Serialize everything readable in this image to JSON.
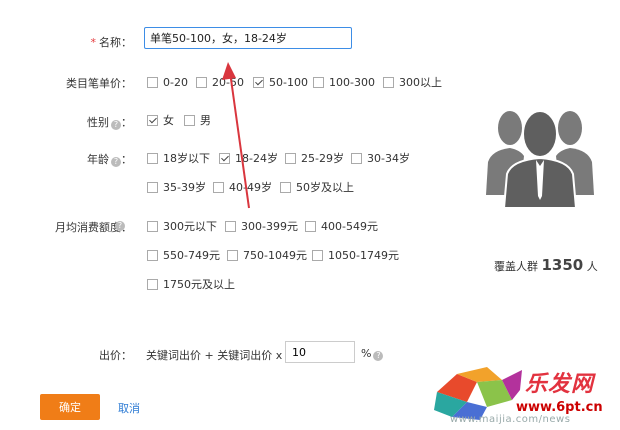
{
  "form": {
    "name_label": "名称：",
    "name_required": "*",
    "name_value": "单笔50-100，女，18-24岁",
    "price_label": "类目笔单价：",
    "price_options": [
      {
        "label": "0-20",
        "checked": false
      },
      {
        "label": "20-50",
        "checked": false
      },
      {
        "label": "50-100",
        "checked": true
      },
      {
        "label": "100-300",
        "checked": false
      },
      {
        "label": "300以上",
        "checked": false
      }
    ],
    "gender_label": "性别",
    "gender_colon": "：",
    "gender_options": [
      {
        "label": "女",
        "checked": true
      },
      {
        "label": "男",
        "checked": false
      }
    ],
    "age_label": "年龄",
    "age_colon": "：",
    "age_options": [
      {
        "label": "18岁以下",
        "checked": false
      },
      {
        "label": "18-24岁",
        "checked": true
      },
      {
        "label": "25-29岁",
        "checked": false
      },
      {
        "label": "30-34岁",
        "checked": false
      },
      {
        "label": "35-39岁",
        "checked": false
      },
      {
        "label": "40-49岁",
        "checked": false
      },
      {
        "label": "50岁及以上",
        "checked": false
      }
    ],
    "spend_label": "月均消费额度：",
    "spend_options": [
      {
        "label": "300元以下",
        "checked": false
      },
      {
        "label": "300-399元",
        "checked": false
      },
      {
        "label": "400-549元",
        "checked": false
      },
      {
        "label": "550-749元",
        "checked": false
      },
      {
        "label": "750-1049元",
        "checked": false
      },
      {
        "label": "1050-1749元",
        "checked": false
      },
      {
        "label": "1750元及以上",
        "checked": false
      }
    ],
    "bid_label": "出价：",
    "bid_formula": "关键词出价 + 关键词出价 x",
    "bid_value": "10",
    "bid_unit": "%",
    "confirm_label": "确定",
    "cancel_label": "取消"
  },
  "coverage": {
    "prefix": "覆盖人群",
    "count": "1350",
    "suffix": "人",
    "icon": "user-group-icon"
  },
  "watermark": {
    "brand": "乐发网",
    "site": "www.6pt.cn",
    "url": "www.maijia.com/news"
  },
  "colors": {
    "accent": "#f07d17",
    "link": "#2d7bd4",
    "required": "#e4393c",
    "icon_gray": "#666666",
    "arrow": "#d9363e"
  }
}
